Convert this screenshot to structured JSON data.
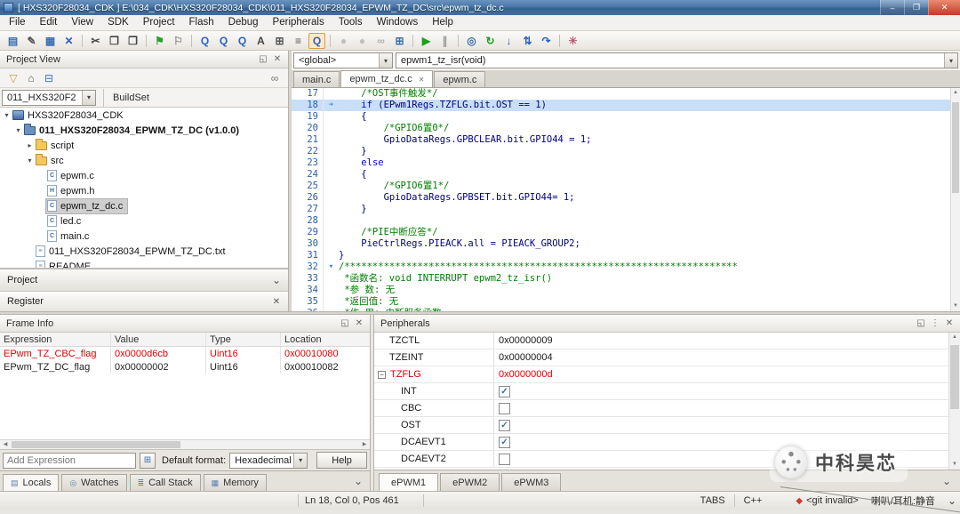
{
  "colors": {
    "accent_blue": "#3a6fb0",
    "changed_red": "#e00000",
    "comment_green": "#008000",
    "keyword_blue": "#0000f0",
    "code_navy": "#00007f",
    "run_green": "#18a018"
  },
  "titlebar": {
    "title": "[ HXS320F28034_CDK ] E:\\034_CDK\\HXS320F28034_CDK\\011_HXS320F28034_EPWM_TZ_DC\\src\\epwm_tz_dc.c",
    "minimize": "–",
    "maximize": "❐",
    "close": "✕"
  },
  "menubar": {
    "items": [
      "File",
      "Edit",
      "View",
      "SDK",
      "Project",
      "Flash",
      "Debug",
      "Peripherals",
      "Tools",
      "Windows",
      "Help"
    ]
  },
  "toolbar": {
    "items": [
      {
        "name": "new-file",
        "glyph": "▤",
        "color": "#3a6fb0"
      },
      {
        "name": "open-file",
        "glyph": "✎",
        "color": "#555555"
      },
      {
        "name": "save-file",
        "glyph": "▦",
        "color": "#3a6fb0"
      },
      {
        "name": "close-file",
        "glyph": "✕",
        "color": "#2b62c4"
      },
      "sep",
      {
        "name": "cut",
        "glyph": "✂",
        "color": "#444444"
      },
      {
        "name": "copy",
        "glyph": "❐",
        "color": "#444444"
      },
      {
        "name": "paste",
        "glyph": "❒",
        "color": "#444444"
      },
      "sep",
      {
        "name": "bookmark-flag",
        "glyph": "⚑",
        "color": "#2a9d2a"
      },
      {
        "name": "bookmark-clear",
        "glyph": "⚐",
        "color": "#888888"
      },
      "sep",
      {
        "name": "search",
        "glyph": "Q",
        "color": "#2b62c4"
      },
      {
        "name": "search-in-files",
        "glyph": "Q",
        "color": "#2b62c4"
      },
      {
        "name": "search-symbol",
        "glyph": "Q",
        "color": "#2b62c4"
      },
      {
        "name": "replace",
        "glyph": "A",
        "color": "#444444"
      },
      {
        "name": "goto-grid",
        "glyph": "⊞",
        "color": "#555555"
      },
      {
        "name": "outline",
        "glyph": "≡",
        "color": "#555555"
      },
      {
        "name": "search-active",
        "glyph": "Q",
        "color": "#2b62c4",
        "boxed": true
      },
      "sep",
      {
        "name": "debug-attach",
        "glyph": "●",
        "color": "#c0c0c0"
      },
      {
        "name": "debug-detach",
        "glyph": "●",
        "color": "#c0c0c0"
      },
      {
        "name": "link",
        "glyph": "∞",
        "color": "#b0b0b0"
      },
      {
        "name": "build-grid",
        "glyph": "⊞",
        "color": "#3a6fb0"
      },
      "sep",
      {
        "name": "run",
        "glyph": "▶",
        "color": "#18a018"
      },
      {
        "name": "pause",
        "glyph": "∥",
        "color": "#999999"
      },
      "sep",
      {
        "name": "debug-target",
        "glyph": "◎",
        "color": "#3a6fb0"
      },
      {
        "name": "restart",
        "glyph": "↻",
        "color": "#18a018"
      },
      {
        "name": "step-into",
        "glyph": "↓",
        "color": "#2b62c4"
      },
      {
        "name": "step-out",
        "glyph": "⇅",
        "color": "#2b62c4"
      },
      {
        "name": "step-over",
        "glyph": "↷",
        "color": "#2b62c4"
      },
      "sep",
      {
        "name": "settings-star",
        "glyph": "✳",
        "color": "#c05878"
      }
    ]
  },
  "symbol_bar": {
    "scope": "<global>",
    "symbol": "epwm1_tz_isr(void)"
  },
  "project_view": {
    "title": "Project View",
    "toolbar_icons": [
      {
        "name": "filter",
        "glyph": "▽",
        "color": "#c99a2e"
      },
      {
        "name": "home",
        "glyph": "⌂",
        "color": "#555555"
      },
      {
        "name": "collapse-all",
        "glyph": "⊟",
        "color": "#3a6fb0"
      },
      {
        "name": "link-with-editor",
        "glyph": "∞",
        "color": "#777777",
        "right": true
      }
    ],
    "buildset_combo": "011_HXS320F2",
    "buildset_label": "BuildSet",
    "tree": [
      {
        "label": "HXS320F28034_CDK",
        "indent": 0,
        "type": "workspace",
        "arrow": "open"
      },
      {
        "label": "011_HXS320F28034_EPWM_TZ_DC (v1.0.0)",
        "indent": 1,
        "type": "project-folder",
        "arrow": "open",
        "bold": true
      },
      {
        "label": "script",
        "indent": 2,
        "type": "folder",
        "arrow": "closed"
      },
      {
        "label": "src",
        "indent": 2,
        "type": "folder",
        "arrow": "open"
      },
      {
        "label": "epwm.c",
        "indent": 3,
        "type": "c-file"
      },
      {
        "label": "epwm.h",
        "indent": 3,
        "type": "h-file"
      },
      {
        "label": "epwm_tz_dc.c",
        "indent": 3,
        "type": "c-file",
        "selected": true
      },
      {
        "label": "led.c",
        "indent": 3,
        "type": "c-file"
      },
      {
        "label": "main.c",
        "indent": 3,
        "type": "c-file"
      },
      {
        "label": "011_HXS320F28034_EPWM_TZ_DC.txt",
        "indent": 2,
        "type": "text-file"
      },
      {
        "label": "README",
        "indent": 2,
        "type": "text-file"
      }
    ],
    "project_bar_label": "Project",
    "register_bar_label": "Register"
  },
  "editor": {
    "tabs": [
      {
        "label": "main.c"
      },
      {
        "label": "epwm_tz_dc.c",
        "active": true,
        "closable": true
      },
      {
        "label": "epwm.c"
      }
    ],
    "current_line": 18,
    "fold_lines": [
      18,
      32
    ],
    "lines": [
      {
        "n": 17,
        "s": [
          [
            "cm",
            "    /*OST事件触发*/"
          ]
        ]
      },
      {
        "n": 18,
        "s": [
          [
            "cd",
            "    "
          ],
          [
            "kw",
            "if"
          ],
          [
            "cd",
            " (EPwm1Regs.TZFLG.bit.OST == 1)"
          ]
        ]
      },
      {
        "n": 19,
        "s": [
          [
            "cd",
            "    {"
          ]
        ]
      },
      {
        "n": 20,
        "s": [
          [
            "cm",
            "        /*GPIO6置0*/"
          ]
        ]
      },
      {
        "n": 21,
        "s": [
          [
            "cd",
            "        GpioDataRegs.GPBCLEAR.bit.GPIO44 = 1;"
          ]
        ]
      },
      {
        "n": 22,
        "s": [
          [
            "cd",
            "    }"
          ]
        ]
      },
      {
        "n": 23,
        "s": [
          [
            "cd",
            "    "
          ],
          [
            "kw",
            "else"
          ]
        ]
      },
      {
        "n": 24,
        "s": [
          [
            "cd",
            "    {"
          ]
        ]
      },
      {
        "n": 25,
        "s": [
          [
            "cm",
            "        /*GPIO6置1*/"
          ]
        ]
      },
      {
        "n": 26,
        "s": [
          [
            "cd",
            "        GpioDataRegs.GPBSET.bit.GPIO44= 1;"
          ]
        ]
      },
      {
        "n": 27,
        "s": [
          [
            "cd",
            "    }"
          ]
        ]
      },
      {
        "n": 28,
        "s": []
      },
      {
        "n": 29,
        "s": [
          [
            "cm",
            "    /*PIE中断应答*/"
          ]
        ]
      },
      {
        "n": 30,
        "s": [
          [
            "cd",
            "    PieCtrlRegs.PIEACK.all = PIEACK_GROUP2;"
          ]
        ]
      },
      {
        "n": 31,
        "s": [
          [
            "cd",
            "}"
          ]
        ]
      },
      {
        "n": 32,
        "s": [
          [
            "cm",
            "/**********************************************************************"
          ]
        ]
      },
      {
        "n": 33,
        "s": [
          [
            "cm",
            " *函数名: void INTERRUPT epwm2_tz_isr()"
          ]
        ]
      },
      {
        "n": 34,
        "s": [
          [
            "cm",
            " *参 数: 无"
          ]
        ]
      },
      {
        "n": 35,
        "s": [
          [
            "cm",
            " *返回值: 无"
          ]
        ]
      },
      {
        "n": 36,
        "s": [
          [
            "cm",
            " *作 用: 中断服务函数"
          ]
        ]
      }
    ]
  },
  "frame_info": {
    "title": "Frame Info",
    "columns": [
      "Expression",
      "Value",
      "Type",
      "Location"
    ],
    "rows": [
      {
        "cells": [
          "EPwm_TZ_CBC_flag",
          "0x0000d6cb",
          "Uint16",
          "0x00010080"
        ],
        "changed": true
      },
      {
        "cells": [
          "EPwm_TZ_DC_flag",
          "0x00000002",
          "Uint16",
          "0x00010082"
        ],
        "changed": false
      }
    ],
    "add_expression_placeholder": "Add Expression",
    "default_format_label": "Default format:",
    "format_value": "Hexadecimal",
    "help_label": "Help",
    "tabs": [
      {
        "label": "Locals",
        "active": true
      },
      {
        "label": "Watches"
      },
      {
        "label": "Call Stack"
      },
      {
        "label": "Memory"
      }
    ]
  },
  "peripherals": {
    "title": "Peripherals",
    "registers": [
      {
        "name": "TZCTL",
        "value": "0x00000009"
      },
      {
        "name": "TZEINT",
        "value": "0x00000004"
      },
      {
        "name": "TZFLG",
        "value": "0x0000000d",
        "changed": true,
        "expanded": true
      },
      {
        "name": "INT",
        "child": true,
        "checked": true
      },
      {
        "name": "CBC",
        "child": true,
        "checked": false
      },
      {
        "name": "OST",
        "child": true,
        "checked": true
      },
      {
        "name": "DCAEVT1",
        "child": true,
        "checked": true
      },
      {
        "name": "DCAEVT2",
        "child": true,
        "checked": false
      }
    ],
    "tabs": [
      {
        "label": "ePWM1",
        "active": true
      },
      {
        "label": "ePWM2"
      },
      {
        "label": "ePWM3"
      }
    ]
  },
  "statusbar": {
    "position": "Ln 18, Col 0, Pos 461",
    "tabs_label": "TABS",
    "lang_label": "C++",
    "git_label": "<git invalid>",
    "audio_label": "喇叭/耳机:静音",
    "chevron": "⌄"
  },
  "watermark": {
    "text": "中科昊芯"
  }
}
